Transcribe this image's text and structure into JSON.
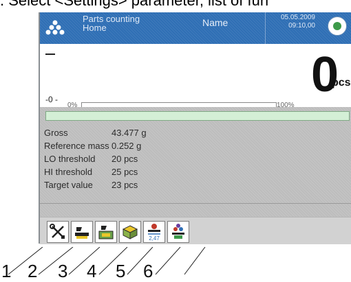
{
  "caption": ". Select <Settings> parameter, list of fun",
  "header": {
    "mode_title": "Parts counting",
    "mode_subtitle": "Home",
    "user": "Name",
    "date": "05.05.2009",
    "time": "09:10,00",
    "accent": "#2f6fb5"
  },
  "display": {
    "zero_indicator": "-0 -",
    "value": "0",
    "unit": "pcs",
    "bar_min": "0%",
    "bar_max": "100%",
    "bar_fill": 0
  },
  "info": {
    "rows": [
      {
        "label": "Gross",
        "value": "43.477 g"
      },
      {
        "label": "Reference mass",
        "value": "0.252 g"
      },
      {
        "label": "LO threshold",
        "value": "20 pcs"
      },
      {
        "label": "HI threshold",
        "value": "25 pcs"
      },
      {
        "label": "Target value",
        "value": "23 pcs"
      }
    ]
  },
  "toolbar": {
    "buttons": [
      {
        "icon": "settings-tools-icon"
      },
      {
        "icon": "tare-icon"
      },
      {
        "icon": "tare-select-icon"
      },
      {
        "icon": "package-icon"
      },
      {
        "icon": "reference-mass-icon",
        "label": "2,47"
      },
      {
        "icon": "sample-count-icon"
      }
    ]
  },
  "callouts": [
    "1",
    "2",
    "3",
    "4",
    "5",
    "6"
  ]
}
